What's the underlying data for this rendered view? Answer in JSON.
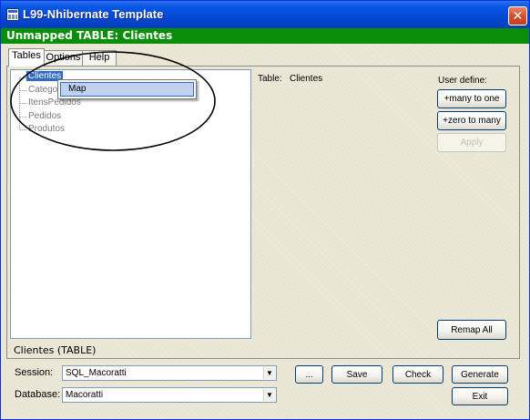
{
  "window": {
    "title": "L99-Nhibernate Template",
    "close_glyph": "✕",
    "header": "Unmapped TABLE: Clientes"
  },
  "tabs": [
    {
      "label": "Tables",
      "active": true
    },
    {
      "label": "Options",
      "active": false
    },
    {
      "label": "Help",
      "active": false
    }
  ],
  "tree": {
    "items": [
      {
        "label": "Clientes",
        "selected": true
      },
      {
        "label": "Categorias",
        "selected": false
      },
      {
        "label": "ItensPedidos",
        "selected": false
      },
      {
        "label": "Pedidos",
        "selected": false
      },
      {
        "label": "Produtos",
        "selected": false
      }
    ]
  },
  "context_menu": {
    "items": [
      {
        "label": "Map"
      }
    ]
  },
  "details": {
    "table_label": "Table:",
    "table_value": "Clientes",
    "user_define_label": "User define:"
  },
  "buttons": {
    "many_to_one": "+many to one",
    "zero_to_many": "+zero to many",
    "apply": "Apply",
    "remap_all": "Remap All",
    "browse": "...",
    "save": "Save",
    "check": "Check",
    "generate": "Generate",
    "exit": "Exit"
  },
  "status": "Clientes (TABLE)",
  "session": {
    "label": "Session:",
    "value": "SQL_Macoratti"
  },
  "database": {
    "label": "Database:",
    "value": "Macoratti"
  },
  "colors": {
    "title_bar": "#0349d4",
    "header_band": "#088e08",
    "selection": "#316ac5"
  }
}
